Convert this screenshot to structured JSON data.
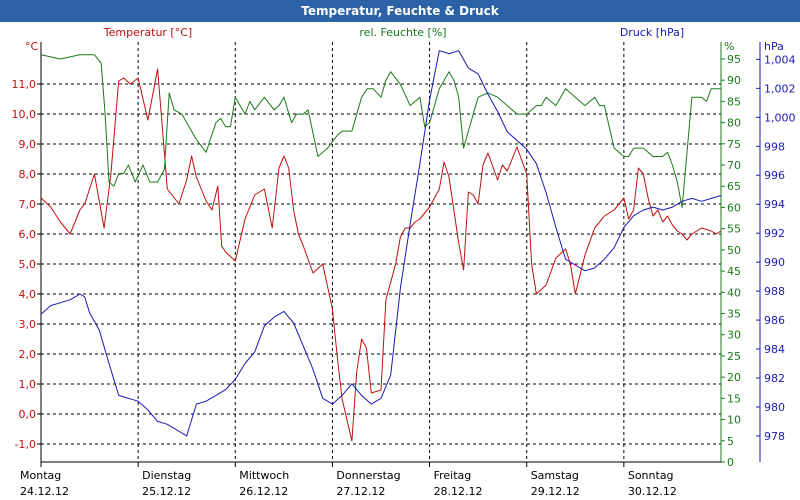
{
  "window": {
    "title": "Temperatur, Feuchte & Druck"
  },
  "colors": {
    "temperature": "#bf1010",
    "humidity": "#1c7a1c",
    "pressure": "#1a1ab4",
    "titlebar": "#2a62a5"
  },
  "chart_data": {
    "type": "line",
    "title": "Temperatur, Feuchte & Druck",
    "grid": true,
    "legend": "top",
    "x_categories": [
      {
        "day": "Montag",
        "date": "24.12.12"
      },
      {
        "day": "Dienstag",
        "date": "25.12.12"
      },
      {
        "day": "Mittwoch",
        "date": "26.12.12"
      },
      {
        "day": "Donnerstag",
        "date": "27.12.12"
      },
      {
        "day": "Freitag",
        "date": "28.12.12"
      },
      {
        "day": "Samstag",
        "date": "29.12.12"
      },
      {
        "day": "Sonntag",
        "date": "30.12.12"
      }
    ],
    "x_range_days": [
      0,
      7
    ],
    "axes": {
      "temperature": {
        "label": "Temperatur [°C]",
        "unit": "°C",
        "range": [
          -1.6,
          12.4
        ],
        "ticks": [
          "-1,0",
          "0,0",
          "1,0",
          "2,0",
          "3,0",
          "4,0",
          "5,0",
          "6,0",
          "7,0",
          "8,0",
          "9,0",
          "10,0",
          "11,0"
        ]
      },
      "humidity": {
        "label": "rel. Feuchte [%]",
        "unit": "%",
        "range": [
          0,
          99
        ],
        "ticks": [
          "0",
          "5",
          "10",
          "15",
          "20",
          "25",
          "30",
          "35",
          "40",
          "45",
          "50",
          "55",
          "60",
          "65",
          "70",
          "75",
          "80",
          "85",
          "90",
          "95"
        ]
      },
      "pressure": {
        "label": "Druck [hPa]",
        "unit": "hPa",
        "range": [
          976.2,
          1005.2
        ],
        "ticks": [
          "978",
          "980",
          "982",
          "984",
          "986",
          "988",
          "990",
          "992",
          "994",
          "996",
          "998",
          "1,000",
          "1,002",
          "1,004"
        ]
      }
    },
    "series": [
      {
        "name": "Temperatur [°C]",
        "axis": "temperature",
        "x": [
          0,
          0.1,
          0.2,
          0.3,
          0.4,
          0.45,
          0.55,
          0.65,
          0.72,
          0.8,
          0.85,
          0.92,
          1.0,
          1.05,
          1.1,
          1.2,
          1.3,
          1.35,
          1.42,
          1.5,
          1.55,
          1.6,
          1.7,
          1.76,
          1.82,
          1.86,
          1.9,
          2.0,
          2.1,
          2.2,
          2.3,
          2.38,
          2.45,
          2.5,
          2.55,
          2.6,
          2.65,
          2.7,
          2.8,
          2.9,
          3.0,
          3.05,
          3.1,
          3.2,
          3.25,
          3.3,
          3.35,
          3.4,
          3.5,
          3.55,
          3.65,
          3.7,
          3.75,
          3.8,
          3.85,
          3.9,
          4.0,
          4.1,
          4.15,
          4.2,
          4.3,
          4.35,
          4.4,
          4.45,
          4.5,
          4.55,
          4.6,
          4.7,
          4.75,
          4.8,
          4.9,
          5.0,
          5.05,
          5.1,
          5.2,
          5.3,
          5.4,
          5.45,
          5.5,
          5.6,
          5.7,
          5.75,
          5.8,
          5.9,
          6.0,
          6.05,
          6.1,
          6.15,
          6.2,
          6.25,
          6.3,
          6.35,
          6.4,
          6.45,
          6.5,
          6.55,
          6.6,
          6.65,
          6.7,
          6.8,
          6.9,
          6.95,
          7.0
        ],
        "values": [
          7.2,
          6.9,
          6.4,
          6.0,
          6.8,
          7.0,
          8.0,
          6.2,
          8.0,
          11.1,
          11.2,
          11.0,
          11.2,
          10.5,
          9.8,
          11.5,
          7.5,
          7.3,
          7.0,
          7.8,
          8.6,
          7.9,
          7.1,
          6.8,
          7.6,
          5.6,
          5.4,
          5.1,
          6.5,
          7.3,
          7.5,
          6.2,
          8.2,
          8.6,
          8.2,
          6.8,
          6.0,
          5.6,
          4.7,
          5.0,
          3.5,
          1.9,
          0.5,
          -0.9,
          1.4,
          2.5,
          2.2,
          0.7,
          0.8,
          3.8,
          5.0,
          5.9,
          6.2,
          6.2,
          6.4,
          6.5,
          6.9,
          7.5,
          8.4,
          7.9,
          5.7,
          4.8,
          7.4,
          7.3,
          7.0,
          8.3,
          8.7,
          7.8,
          8.3,
          8.1,
          8.9,
          8.0,
          5.0,
          4.0,
          4.3,
          5.2,
          5.5,
          5.0,
          4.0,
          5.3,
          6.2,
          6.4,
          6.6,
          6.8,
          7.2,
          6.5,
          6.8,
          8.2,
          8.0,
          7.2,
          6.6,
          6.8,
          6.4,
          6.6,
          6.3,
          6.1,
          6.0,
          5.8,
          6.0,
          6.2,
          6.1,
          6.0,
          6.1
        ]
      },
      {
        "name": "rel. Feuchte [%]",
        "axis": "humidity",
        "x": [
          0,
          0.2,
          0.4,
          0.55,
          0.62,
          0.66,
          0.7,
          0.75,
          0.8,
          0.85,
          0.9,
          0.97,
          1.05,
          1.12,
          1.2,
          1.27,
          1.32,
          1.37,
          1.45,
          1.5,
          1.6,
          1.7,
          1.8,
          1.85,
          1.9,
          1.95,
          2.0,
          2.1,
          2.15,
          2.2,
          2.3,
          2.4,
          2.45,
          2.5,
          2.58,
          2.63,
          2.7,
          2.75,
          2.85,
          2.95,
          3.05,
          3.1,
          3.2,
          3.3,
          3.36,
          3.42,
          3.5,
          3.55,
          3.6,
          3.7,
          3.8,
          3.9,
          3.95,
          4.0,
          4.1,
          4.2,
          4.25,
          4.3,
          4.35,
          4.4,
          4.5,
          4.6,
          4.7,
          4.8,
          4.9,
          5.0,
          5.1,
          5.15,
          5.2,
          5.3,
          5.4,
          5.5,
          5.6,
          5.7,
          5.75,
          5.8,
          5.9,
          6.0,
          6.05,
          6.1,
          6.2,
          6.3,
          6.4,
          6.45,
          6.5,
          6.55,
          6.6,
          6.7,
          6.8,
          6.85,
          6.9,
          7.0
        ],
        "values": [
          96,
          95,
          96,
          96,
          94,
          82,
          66,
          65,
          68,
          68,
          70,
          66,
          70,
          66,
          66,
          69,
          87,
          83,
          82,
          80,
          76,
          73,
          80,
          81,
          79,
          79,
          86,
          82,
          85,
          83,
          86,
          83,
          84,
          86,
          80,
          82,
          82,
          83,
          72,
          74,
          77,
          78,
          78,
          86,
          88,
          88,
          86,
          90,
          92,
          89,
          84,
          86,
          79,
          80,
          88,
          92,
          90,
          86,
          74,
          78,
          86,
          87,
          86,
          84,
          82,
          82,
          84,
          84,
          86,
          84,
          88,
          86,
          84,
          86,
          84,
          84,
          74,
          72,
          72,
          74,
          74,
          72,
          72,
          73,
          70,
          66,
          60,
          86,
          86,
          85,
          88,
          88
        ]
      },
      {
        "name": "Druck [hPa]",
        "axis": "pressure",
        "x": [
          0,
          0.1,
          0.2,
          0.3,
          0.4,
          0.45,
          0.5,
          0.6,
          0.7,
          0.8,
          0.9,
          1.0,
          1.1,
          1.2,
          1.3,
          1.4,
          1.5,
          1.6,
          1.7,
          1.8,
          1.9,
          2.0,
          2.1,
          2.2,
          2.3,
          2.4,
          2.5,
          2.6,
          2.7,
          2.8,
          2.9,
          3.0,
          3.1,
          3.2,
          3.3,
          3.4,
          3.5,
          3.6,
          3.7,
          3.8,
          3.9,
          4.0,
          4.1,
          4.2,
          4.3,
          4.4,
          4.5,
          4.6,
          4.7,
          4.8,
          4.9,
          5.0,
          5.1,
          5.2,
          5.3,
          5.4,
          5.5,
          5.6,
          5.7,
          5.8,
          5.9,
          6.0,
          6.1,
          6.2,
          6.3,
          6.4,
          6.5,
          6.6,
          6.7,
          6.8,
          6.9,
          7.0
        ],
        "values": [
          986.4,
          987.0,
          987.2,
          987.4,
          987.8,
          987.6,
          986.5,
          985.3,
          983.0,
          980.8,
          980.6,
          980.4,
          979.8,
          979.0,
          978.8,
          978.4,
          978.0,
          980.2,
          980.4,
          980.8,
          981.2,
          981.9,
          983.0,
          983.8,
          985.6,
          986.2,
          986.6,
          985.8,
          984.2,
          982.6,
          980.6,
          980.2,
          980.8,
          981.6,
          980.8,
          980.2,
          980.6,
          982.2,
          988.2,
          992.6,
          996.8,
          1001.2,
          1004.6,
          1004.4,
          1004.6,
          1003.4,
          1003.0,
          1001.6,
          1000.4,
          999.0,
          998.4,
          997.8,
          996.8,
          994.8,
          992.4,
          990.2,
          989.8,
          989.4,
          989.6,
          990.2,
          991.0,
          992.4,
          993.2,
          993.6,
          993.8,
          993.6,
          993.8,
          994.2,
          994.4,
          994.2,
          994.4,
          994.6
        ]
      }
    ]
  }
}
